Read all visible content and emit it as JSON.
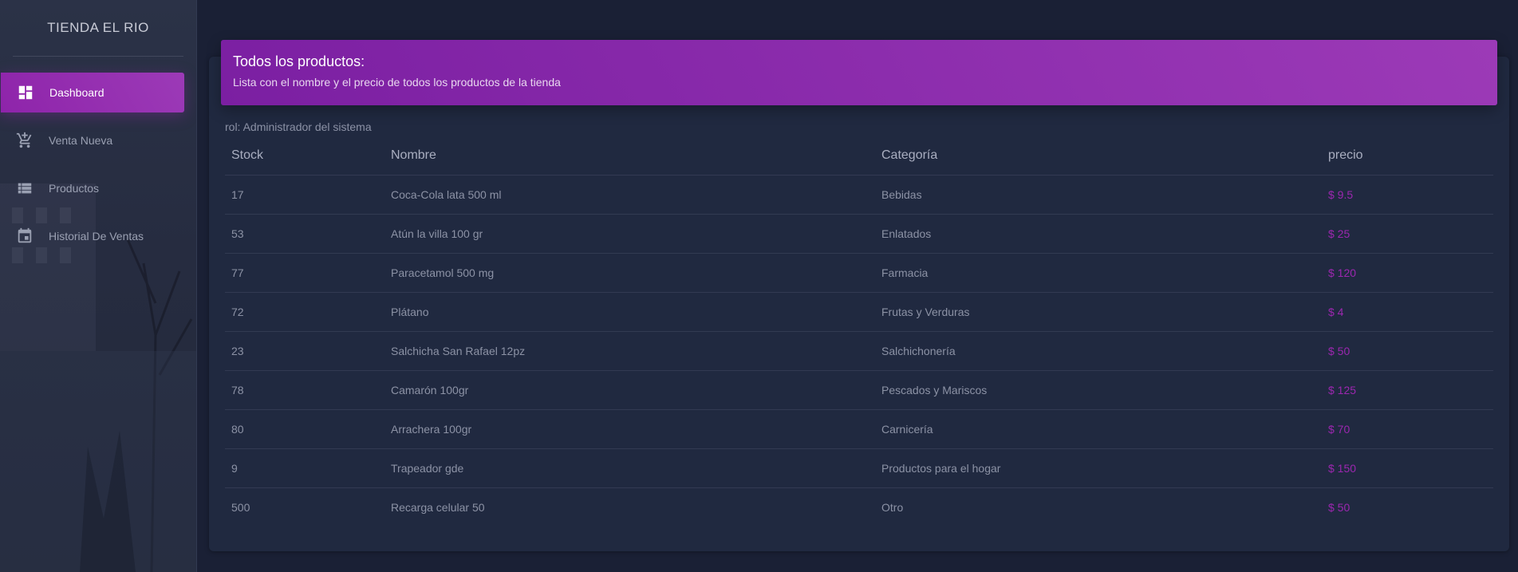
{
  "sidebar": {
    "brand": "TIENDA EL RIO",
    "items": [
      {
        "label": "Dashboard",
        "icon": "dashboard-icon",
        "active": true
      },
      {
        "label": "Venta Nueva",
        "icon": "add-shopping-cart-icon",
        "active": false
      },
      {
        "label": "Productos",
        "icon": "list-icon",
        "active": false
      },
      {
        "label": "Historial De Ventas",
        "icon": "calendar-icon",
        "active": false
      }
    ]
  },
  "header": {
    "title": "Todos los productos:",
    "subtitle": "Lista con el nombre y el precio de todos los productos de la tienda"
  },
  "role": "rol: Administrador del sistema",
  "table": {
    "columns": [
      "Stock",
      "Nombre",
      "Categoría",
      "precio"
    ],
    "rows": [
      {
        "stock": "17",
        "name": "Coca-Cola lata 500 ml",
        "category": "Bebidas",
        "price": "$ 9.5"
      },
      {
        "stock": "53",
        "name": "Atún la villa 100 gr",
        "category": "Enlatados",
        "price": "$ 25"
      },
      {
        "stock": "77",
        "name": "Paracetamol 500 mg",
        "category": "Farmacia",
        "price": "$ 120"
      },
      {
        "stock": "72",
        "name": "Plátano",
        "category": "Frutas y Verduras",
        "price": "$ 4"
      },
      {
        "stock": "23",
        "name": "Salchicha San Rafael 12pz",
        "category": "Salchichonería",
        "price": "$ 50"
      },
      {
        "stock": "78",
        "name": "Camarón 100gr",
        "category": "Pescados y Mariscos",
        "price": "$ 125"
      },
      {
        "stock": "80",
        "name": "Arrachera 100gr",
        "category": "Carnicería",
        "price": "$ 70"
      },
      {
        "stock": "9",
        "name": "Trapeador gde",
        "category": "Productos para el hogar",
        "price": "$ 150"
      },
      {
        "stock": "500",
        "name": "Recarga celular 50",
        "category": "Otro",
        "price": "$ 50"
      }
    ]
  },
  "colors": {
    "accent": "#9c27b0",
    "background": "#1a2035",
    "card": "#202940"
  }
}
